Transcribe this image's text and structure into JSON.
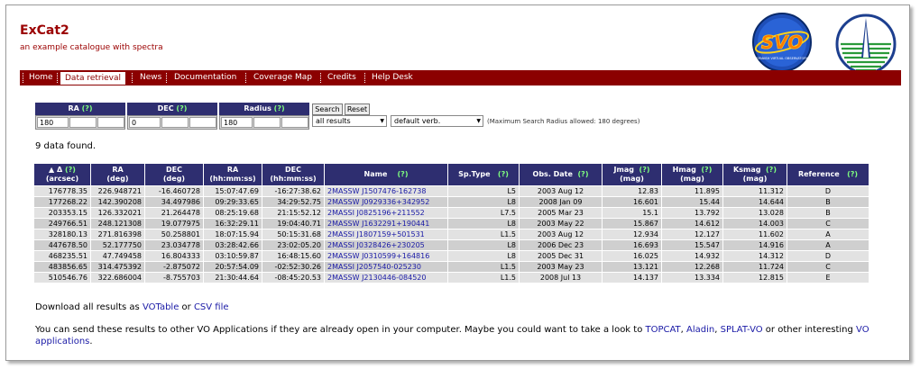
{
  "header": {
    "title": "ExCat2",
    "subtitle": "an example catalogue with spectra",
    "logo_text": "SVO"
  },
  "nav": {
    "items": [
      "Home",
      "Data retrieval",
      "News",
      "Documentation",
      "Coverage Map",
      "Credits",
      "Help Desk"
    ],
    "active": "Data retrieval"
  },
  "query": {
    "ra_label": "RA",
    "dec_label": "DEC",
    "radius_label": "Radius",
    "help": "(?)",
    "ra_value": "180",
    "dec_value": "0",
    "radius_value": "180",
    "search_button": "Search",
    "reset_button": "Reset",
    "results_select": "all results",
    "verb_select": "default verb.",
    "max_info": "(Maximum Search Radius allowed: 180 degrees)"
  },
  "results": {
    "count_text": "9 data found.",
    "headers": [
      {
        "l1": "▲ Δ",
        "help": "(?)",
        "l2": "(arcsec)"
      },
      {
        "l1": "RA",
        "help": "",
        "l2": "(deg)"
      },
      {
        "l1": "DEC",
        "help": "",
        "l2": "(deg)"
      },
      {
        "l1": "RA",
        "help": "",
        "l2": "(hh:mm:ss)"
      },
      {
        "l1": "DEC",
        "help": "",
        "l2": "(hh:mm:ss)"
      },
      {
        "l1": "Name",
        "help": "(?)",
        "l2": ""
      },
      {
        "l1": "Sp.Type",
        "help": "(?)",
        "l2": ""
      },
      {
        "l1": "Obs. Date",
        "help": "(?)",
        "l2": ""
      },
      {
        "l1": "Jmag",
        "help": "(?)",
        "l2": "(mag)"
      },
      {
        "l1": "Hmag",
        "help": "(?)",
        "l2": "(mag)"
      },
      {
        "l1": "Ksmag",
        "help": "(?)",
        "l2": "(mag)"
      },
      {
        "l1": "Reference",
        "help": "(?)",
        "l2": ""
      }
    ],
    "rows": [
      [
        "176778.35",
        "226.948721",
        "-16.460728",
        "15:07:47.69",
        "-16:27:38.62",
        "2MASSW J1507476-162738",
        "L5",
        "2003 Aug 12",
        "12.83",
        "11.895",
        "11.312",
        "D"
      ],
      [
        "177268.22",
        "142.390208",
        "34.497986",
        "09:29:33.65",
        "34:29:52.75",
        "2MASSW J0929336+342952",
        "L8",
        "2008 Jan 09",
        "16.601",
        "15.44",
        "14.644",
        "B"
      ],
      [
        "203353.15",
        "126.332021",
        "21.264478",
        "08:25:19.68",
        "21:15:52.12",
        "2MASSI J0825196+211552",
        "L7.5",
        "2005 Mar 23",
        "15.1",
        "13.792",
        "13.028",
        "B"
      ],
      [
        "249766.51",
        "248.121308",
        "19.077975",
        "16:32:29.11",
        "19:04:40.71",
        "2MASSW J1632291+190441",
        "L8",
        "2003 May 22",
        "15.867",
        "14.612",
        "14.003",
        "C"
      ],
      [
        "328180.13",
        "271.816398",
        "50.258801",
        "18:07:15.94",
        "50:15:31.68",
        "2MASSI J1807159+501531",
        "L1.5",
        "2003 Aug 12",
        "12.934",
        "12.127",
        "11.602",
        "A"
      ],
      [
        "447678.50",
        "52.177750",
        "23.034778",
        "03:28:42.66",
        "23:02:05.20",
        "2MASSI J0328426+230205",
        "L8",
        "2006 Dec 23",
        "16.693",
        "15.547",
        "14.916",
        "A"
      ],
      [
        "468235.51",
        "47.749458",
        "16.804333",
        "03:10:59.87",
        "16:48:15.60",
        "2MASSW J0310599+164816",
        "L8",
        "2005 Dec 31",
        "16.025",
        "14.932",
        "14.312",
        "D"
      ],
      [
        "483856.65",
        "314.475392",
        "-2.875072",
        "20:57:54.09",
        "-02:52:30.26",
        "2MASSI J2057540-025230",
        "L1.5",
        "2003 May 23",
        "13.121",
        "12.268",
        "11.724",
        "C"
      ],
      [
        "510546.76",
        "322.686004",
        "-8.755703",
        "21:30:44.64",
        "-08:45:20.53",
        "2MASSW J2130446-084520",
        "L1.5",
        "2008 Jul 13",
        "14.137",
        "13.334",
        "12.815",
        "E"
      ]
    ]
  },
  "download": {
    "prefix": "Download all results as ",
    "votable": "VOTable",
    "or": " or ",
    "csv": "CSV file"
  },
  "send": {
    "text": "You can send these results to other VO Applications if they are already open in your computer. Maybe you could want to take a look to ",
    "topcat": "TOPCAT",
    "comma1": ", ",
    "aladin": "Aladin",
    "comma2": ", ",
    "splat": "SPLAT-VO",
    "or_other": " or other interesting ",
    "vo_apps": "VO applications",
    "end": "."
  },
  "colors": {
    "brand": "#8b0000",
    "header_bg": "#2e2e70",
    "help_green": "#7fff7f",
    "link": "#1a1aa6"
  }
}
